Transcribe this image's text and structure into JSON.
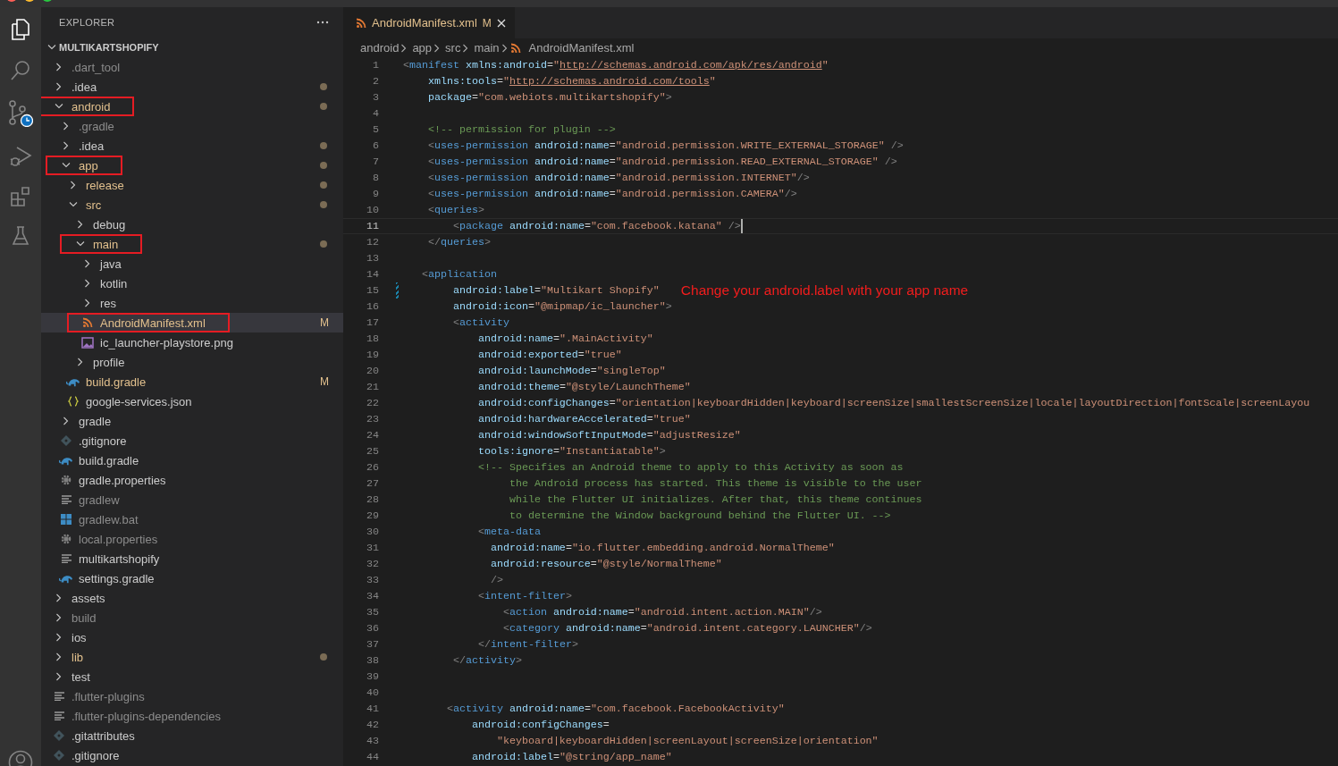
{
  "explorer": {
    "title": "EXPLORER",
    "root": {
      "label": "MULTIKARTSHOPIFY",
      "expanded": true,
      "children": [
        {
          "label": ".dart_tool",
          "kind": "folder",
          "expanded": false,
          "modified": false,
          "ignored": true,
          "dot": false,
          "selected": false,
          "highlighted": false
        },
        {
          "label": ".idea",
          "kind": "folder",
          "expanded": false,
          "modified": false,
          "ignored": false,
          "dot": true,
          "selected": false,
          "highlighted": false
        },
        {
          "label": "android",
          "kind": "folder",
          "expanded": true,
          "modified": true,
          "ignored": false,
          "dot": true,
          "selected": false,
          "highlighted": true,
          "children": [
            {
              "label": ".gradle",
              "kind": "folder",
              "expanded": false,
              "modified": false,
              "ignored": true,
              "dot": false,
              "selected": false,
              "highlighted": false
            },
            {
              "label": ".idea",
              "kind": "folder",
              "expanded": false,
              "modified": false,
              "ignored": false,
              "dot": true,
              "selected": false,
              "highlighted": false
            },
            {
              "label": "app",
              "kind": "folder",
              "expanded": true,
              "modified": true,
              "ignored": false,
              "dot": true,
              "selected": false,
              "highlighted": true,
              "children": [
                {
                  "label": "release",
                  "kind": "folder",
                  "expanded": false,
                  "modified": true,
                  "ignored": false,
                  "dot": true,
                  "selected": false,
                  "highlighted": false
                },
                {
                  "label": "src",
                  "kind": "folder",
                  "expanded": true,
                  "modified": true,
                  "ignored": false,
                  "dot": true,
                  "selected": false,
                  "highlighted": false,
                  "children": [
                    {
                      "label": "debug",
                      "kind": "folder",
                      "expanded": false,
                      "modified": false,
                      "ignored": false,
                      "dot": false,
                      "selected": false,
                      "highlighted": false
                    },
                    {
                      "label": "main",
                      "kind": "folder",
                      "expanded": true,
                      "modified": true,
                      "ignored": false,
                      "dot": true,
                      "selected": false,
                      "highlighted": true,
                      "children": [
                        {
                          "label": "java",
                          "kind": "folder",
                          "expanded": false,
                          "modified": false,
                          "ignored": false,
                          "dot": false,
                          "selected": false,
                          "highlighted": false
                        },
                        {
                          "label": "kotlin",
                          "kind": "folder",
                          "expanded": false,
                          "modified": false,
                          "ignored": false,
                          "dot": false,
                          "selected": false,
                          "highlighted": false
                        },
                        {
                          "label": "res",
                          "kind": "folder",
                          "expanded": false,
                          "modified": false,
                          "ignored": false,
                          "dot": false,
                          "selected": false,
                          "highlighted": false
                        },
                        {
                          "label": "AndroidManifest.xml",
                          "kind": "xml",
                          "modified": true,
                          "ignored": false,
                          "badge": "M",
                          "dot": false,
                          "selected": true,
                          "highlighted": true
                        },
                        {
                          "label": "ic_launcher-playstore.png",
                          "kind": "image",
                          "modified": false,
                          "ignored": false,
                          "dot": false,
                          "selected": false,
                          "highlighted": false
                        }
                      ]
                    },
                    {
                      "label": "profile",
                      "kind": "folder",
                      "expanded": false,
                      "modified": false,
                      "ignored": false,
                      "dot": false,
                      "selected": false,
                      "highlighted": false
                    }
                  ]
                },
                {
                  "label": "build.gradle",
                  "kind": "gradle",
                  "modified": true,
                  "ignored": false,
                  "badge": "M",
                  "dot": false,
                  "selected": false,
                  "highlighted": false
                },
                {
                  "label": "google-services.json",
                  "kind": "json",
                  "modified": false,
                  "ignored": false,
                  "dot": false,
                  "selected": false,
                  "highlighted": false
                }
              ]
            },
            {
              "label": "gradle",
              "kind": "folder",
              "expanded": false,
              "modified": false,
              "ignored": false,
              "dot": false,
              "selected": false,
              "highlighted": false
            },
            {
              "label": ".gitignore",
              "kind": "git",
              "modified": false,
              "ignored": false,
              "dot": false,
              "selected": false,
              "highlighted": false
            },
            {
              "label": "build.gradle",
              "kind": "gradle",
              "modified": false,
              "ignored": false,
              "dot": false,
              "selected": false,
              "highlighted": false
            },
            {
              "label": "gradle.properties",
              "kind": "settings",
              "modified": false,
              "ignored": false,
              "dot": false,
              "selected": false,
              "highlighted": false
            },
            {
              "label": "gradlew",
              "kind": "text",
              "modified": false,
              "ignored": true,
              "dot": false,
              "selected": false,
              "highlighted": false
            },
            {
              "label": "gradlew.bat",
              "kind": "windows",
              "modified": false,
              "ignored": true,
              "dot": false,
              "selected": false,
              "highlighted": false
            },
            {
              "label": "local.properties",
              "kind": "settings",
              "modified": false,
              "ignored": true,
              "dot": false,
              "selected": false,
              "highlighted": false
            },
            {
              "label": "multikartshopify",
              "kind": "text",
              "modified": false,
              "ignored": false,
              "dot": false,
              "selected": false,
              "highlighted": false
            },
            {
              "label": "settings.gradle",
              "kind": "gradle",
              "modified": false,
              "ignored": false,
              "dot": false,
              "selected": false,
              "highlighted": false
            }
          ]
        },
        {
          "label": "assets",
          "kind": "folder",
          "expanded": false,
          "modified": false,
          "ignored": false,
          "dot": false,
          "selected": false,
          "highlighted": false
        },
        {
          "label": "build",
          "kind": "folder",
          "expanded": false,
          "modified": false,
          "ignored": true,
          "dot": false,
          "selected": false,
          "highlighted": false
        },
        {
          "label": "ios",
          "kind": "folder",
          "expanded": false,
          "modified": false,
          "ignored": false,
          "dot": false,
          "selected": false,
          "highlighted": false
        },
        {
          "label": "lib",
          "kind": "folder",
          "expanded": false,
          "modified": true,
          "ignored": false,
          "dot": true,
          "selected": false,
          "highlighted": false
        },
        {
          "label": "test",
          "kind": "folder",
          "expanded": false,
          "modified": false,
          "ignored": false,
          "dot": false,
          "selected": false,
          "highlighted": false
        },
        {
          "label": ".flutter-plugins",
          "kind": "text",
          "modified": false,
          "ignored": true,
          "dot": false,
          "selected": false,
          "highlighted": false
        },
        {
          "label": ".flutter-plugins-dependencies",
          "kind": "text",
          "modified": false,
          "ignored": true,
          "dot": false,
          "selected": false,
          "highlighted": false
        },
        {
          "label": ".gitattributes",
          "kind": "git",
          "modified": false,
          "ignored": false,
          "dot": false,
          "selected": false,
          "highlighted": false
        },
        {
          "label": ".gitignore",
          "kind": "git",
          "modified": false,
          "ignored": false,
          "dot": false,
          "selected": false,
          "highlighted": false
        }
      ]
    }
  },
  "editor": {
    "tabs": [
      {
        "label": "AndroidManifest.xml",
        "kind": "xml",
        "badge": "M",
        "modified": true,
        "selected": true
      }
    ],
    "breadcrumbs": [
      {
        "label": "android",
        "kind": "folder"
      },
      {
        "label": "app",
        "kind": "folder"
      },
      {
        "label": "src",
        "kind": "folder"
      },
      {
        "label": "main",
        "kind": "folder"
      },
      {
        "label": "AndroidManifest.xml",
        "kind": "xml"
      }
    ],
    "lines": [
      {
        "number": "1",
        "current": false,
        "changed": false,
        "tokens": [
          {
            "kind": "punct",
            "text": "<"
          },
          {
            "kind": "tag",
            "text": "manifest"
          },
          {
            "kind": "attr",
            "text": " xmlns:android"
          },
          {
            "kind": "eq",
            "text": "="
          },
          {
            "kind": "string",
            "text": "\""
          },
          {
            "kind": "link",
            "text": "http://schemas.android.com/apk/res/android"
          },
          {
            "kind": "string",
            "text": "\""
          }
        ]
      },
      {
        "number": "2",
        "current": false,
        "changed": false,
        "tokens": [
          {
            "kind": "attr",
            "text": "    xmlns:tools"
          },
          {
            "kind": "eq",
            "text": "="
          },
          {
            "kind": "string",
            "text": "\""
          },
          {
            "kind": "link",
            "text": "http://schemas.android.com/tools"
          },
          {
            "kind": "string",
            "text": "\""
          }
        ]
      },
      {
        "number": "3",
        "current": false,
        "changed": false,
        "tokens": [
          {
            "kind": "attr",
            "text": "    package"
          },
          {
            "kind": "eq",
            "text": "="
          },
          {
            "kind": "string",
            "text": "\"com.webiots.multikartshopify\""
          },
          {
            "kind": "punct",
            "text": ">"
          }
        ]
      },
      {
        "number": "4",
        "current": false,
        "changed": false
      },
      {
        "number": "5",
        "current": false,
        "changed": false,
        "tokens": [
          {
            "kind": "comment",
            "text": "    <!-- permission for plugin -->"
          }
        ]
      },
      {
        "number": "6",
        "current": false,
        "changed": false,
        "tokens": [
          {
            "kind": "punct",
            "text": "    <"
          },
          {
            "kind": "tag",
            "text": "uses-permission"
          },
          {
            "kind": "attr",
            "text": " android:name"
          },
          {
            "kind": "eq",
            "text": "="
          },
          {
            "kind": "string",
            "text": "\"android.permission.WRITE_EXTERNAL_STORAGE\""
          },
          {
            "kind": "punct",
            "text": " />"
          }
        ]
      },
      {
        "number": "7",
        "current": false,
        "changed": false,
        "tokens": [
          {
            "kind": "punct",
            "text": "    <"
          },
          {
            "kind": "tag",
            "text": "uses-permission"
          },
          {
            "kind": "attr",
            "text": " android:name"
          },
          {
            "kind": "eq",
            "text": "="
          },
          {
            "kind": "string",
            "text": "\"android.permission.READ_EXTERNAL_STORAGE\""
          },
          {
            "kind": "punct",
            "text": " />"
          }
        ]
      },
      {
        "number": "8",
        "current": false,
        "changed": false,
        "tokens": [
          {
            "kind": "punct",
            "text": "    <"
          },
          {
            "kind": "tag",
            "text": "uses-permission"
          },
          {
            "kind": "attr",
            "text": " android:name"
          },
          {
            "kind": "eq",
            "text": "="
          },
          {
            "kind": "string",
            "text": "\"android.permission.INTERNET\""
          },
          {
            "kind": "punct",
            "text": "/>"
          }
        ]
      },
      {
        "number": "9",
        "current": false,
        "changed": false,
        "tokens": [
          {
            "kind": "punct",
            "text": "    <"
          },
          {
            "kind": "tag",
            "text": "uses-permission"
          },
          {
            "kind": "attr",
            "text": " android:name"
          },
          {
            "kind": "eq",
            "text": "="
          },
          {
            "kind": "string",
            "text": "\"android.permission.CAMERA\""
          },
          {
            "kind": "punct",
            "text": "/>"
          }
        ]
      },
      {
        "number": "10",
        "current": false,
        "changed": false,
        "tokens": [
          {
            "kind": "punct",
            "text": "    <"
          },
          {
            "kind": "tag",
            "text": "queries"
          },
          {
            "kind": "punct",
            "text": ">"
          }
        ]
      },
      {
        "number": "11",
        "current": true,
        "changed": false,
        "tokens": [
          {
            "kind": "punct",
            "text": "        <"
          },
          {
            "kind": "tag",
            "text": "package"
          },
          {
            "kind": "attr",
            "text": " android:name"
          },
          {
            "kind": "eq",
            "text": "="
          },
          {
            "kind": "string",
            "text": "\"com.facebook.katana\""
          },
          {
            "kind": "punct",
            "text": " />"
          }
        ]
      },
      {
        "number": "12",
        "current": false,
        "changed": false,
        "tokens": [
          {
            "kind": "punct",
            "text": "    </"
          },
          {
            "kind": "tag",
            "text": "queries"
          },
          {
            "kind": "punct",
            "text": ">"
          }
        ]
      },
      {
        "number": "13",
        "current": false,
        "changed": false
      },
      {
        "number": "14",
        "current": false,
        "changed": false,
        "tokens": [
          {
            "kind": "punct",
            "text": "   <"
          },
          {
            "kind": "tag",
            "text": "application"
          }
        ]
      },
      {
        "number": "15",
        "current": false,
        "changed": true,
        "note": "Change your android.label with your app name",
        "tokens": [
          {
            "kind": "attr",
            "text": "        android:label"
          },
          {
            "kind": "eq",
            "text": "="
          },
          {
            "kind": "string",
            "text": "\"Multikart Shopify\""
          }
        ]
      },
      {
        "number": "16",
        "current": false,
        "changed": false,
        "tokens": [
          {
            "kind": "attr",
            "text": "        android:icon"
          },
          {
            "kind": "eq",
            "text": "="
          },
          {
            "kind": "string",
            "text": "\"@mipmap/ic_launcher\""
          },
          {
            "kind": "punct",
            "text": ">"
          }
        ]
      },
      {
        "number": "17",
        "current": false,
        "changed": false,
        "tokens": [
          {
            "kind": "punct",
            "text": "        <"
          },
          {
            "kind": "tag",
            "text": "activity"
          }
        ]
      },
      {
        "number": "18",
        "current": false,
        "changed": false,
        "tokens": [
          {
            "kind": "attr",
            "text": "            android:name"
          },
          {
            "kind": "eq",
            "text": "="
          },
          {
            "kind": "string",
            "text": "\".MainActivity\""
          }
        ]
      },
      {
        "number": "19",
        "current": false,
        "changed": false,
        "tokens": [
          {
            "kind": "attr",
            "text": "            android:exported"
          },
          {
            "kind": "eq",
            "text": "="
          },
          {
            "kind": "string",
            "text": "\"true\""
          }
        ]
      },
      {
        "number": "20",
        "current": false,
        "changed": false,
        "tokens": [
          {
            "kind": "attr",
            "text": "            android:launchMode"
          },
          {
            "kind": "eq",
            "text": "="
          },
          {
            "kind": "string",
            "text": "\"singleTop\""
          }
        ]
      },
      {
        "number": "21",
        "current": false,
        "changed": false,
        "tokens": [
          {
            "kind": "attr",
            "text": "            android:theme"
          },
          {
            "kind": "eq",
            "text": "="
          },
          {
            "kind": "string",
            "text": "\"@style/LaunchTheme\""
          }
        ]
      },
      {
        "number": "22",
        "current": false,
        "changed": false,
        "tokens": [
          {
            "kind": "attr",
            "text": "            android:configChanges"
          },
          {
            "kind": "eq",
            "text": "="
          },
          {
            "kind": "string",
            "text": "\"orientation|keyboardHidden|keyboard|screenSize|smallestScreenSize|locale|layoutDirection|fontScale|screenLayou"
          }
        ]
      },
      {
        "number": "23",
        "current": false,
        "changed": false,
        "tokens": [
          {
            "kind": "attr",
            "text": "            android:hardwareAccelerated"
          },
          {
            "kind": "eq",
            "text": "="
          },
          {
            "kind": "string",
            "text": "\"true\""
          }
        ]
      },
      {
        "number": "24",
        "current": false,
        "changed": false,
        "tokens": [
          {
            "kind": "attr",
            "text": "            android:windowSoftInputMode"
          },
          {
            "kind": "eq",
            "text": "="
          },
          {
            "kind": "string",
            "text": "\"adjustResize\""
          }
        ]
      },
      {
        "number": "25",
        "current": false,
        "changed": false,
        "tokens": [
          {
            "kind": "attr",
            "text": "            tools:ignore"
          },
          {
            "kind": "eq",
            "text": "="
          },
          {
            "kind": "string",
            "text": "\"Instantiatable\""
          },
          {
            "kind": "punct",
            "text": ">"
          }
        ]
      },
      {
        "number": "26",
        "current": false,
        "changed": false,
        "tokens": [
          {
            "kind": "comment",
            "text": "            <!-- Specifies an Android theme to apply to this Activity as soon as"
          }
        ]
      },
      {
        "number": "27",
        "current": false,
        "changed": false,
        "tokens": [
          {
            "kind": "comment",
            "text": "                 the Android process has started. This theme is visible to the user"
          }
        ]
      },
      {
        "number": "28",
        "current": false,
        "changed": false,
        "tokens": [
          {
            "kind": "comment",
            "text": "                 while the Flutter UI initializes. After that, this theme continues"
          }
        ]
      },
      {
        "number": "29",
        "current": false,
        "changed": false,
        "tokens": [
          {
            "kind": "comment",
            "text": "                 to determine the Window background behind the Flutter UI. -->"
          }
        ]
      },
      {
        "number": "30",
        "current": false,
        "changed": false,
        "tokens": [
          {
            "kind": "punct",
            "text": "            <"
          },
          {
            "kind": "tag",
            "text": "meta-data"
          }
        ]
      },
      {
        "number": "31",
        "current": false,
        "changed": false,
        "tokens": [
          {
            "kind": "attr",
            "text": "              android:name"
          },
          {
            "kind": "eq",
            "text": "="
          },
          {
            "kind": "string",
            "text": "\"io.flutter.embedding.android.NormalTheme\""
          }
        ]
      },
      {
        "number": "32",
        "current": false,
        "changed": false,
        "tokens": [
          {
            "kind": "attr",
            "text": "              android:resource"
          },
          {
            "kind": "eq",
            "text": "="
          },
          {
            "kind": "string",
            "text": "\"@style/NormalTheme\""
          }
        ]
      },
      {
        "number": "33",
        "current": false,
        "changed": false,
        "tokens": [
          {
            "kind": "punct",
            "text": "              />"
          }
        ]
      },
      {
        "number": "34",
        "current": false,
        "changed": false,
        "tokens": [
          {
            "kind": "punct",
            "text": "            <"
          },
          {
            "kind": "tag",
            "text": "intent-filter"
          },
          {
            "kind": "punct",
            "text": ">"
          }
        ]
      },
      {
        "number": "35",
        "current": false,
        "changed": false,
        "tokens": [
          {
            "kind": "punct",
            "text": "                <"
          },
          {
            "kind": "tag",
            "text": "action"
          },
          {
            "kind": "attr",
            "text": " android:name"
          },
          {
            "kind": "eq",
            "text": "="
          },
          {
            "kind": "string",
            "text": "\"android.intent.action.MAIN\""
          },
          {
            "kind": "punct",
            "text": "/>"
          }
        ]
      },
      {
        "number": "36",
        "current": false,
        "changed": false,
        "tokens": [
          {
            "kind": "punct",
            "text": "                <"
          },
          {
            "kind": "tag",
            "text": "category"
          },
          {
            "kind": "attr",
            "text": " android:name"
          },
          {
            "kind": "eq",
            "text": "="
          },
          {
            "kind": "string",
            "text": "\"android.intent.category.LAUNCHER\""
          },
          {
            "kind": "punct",
            "text": "/>"
          }
        ]
      },
      {
        "number": "37",
        "current": false,
        "changed": false,
        "tokens": [
          {
            "kind": "punct",
            "text": "            </"
          },
          {
            "kind": "tag",
            "text": "intent-filter"
          },
          {
            "kind": "punct",
            "text": ">"
          }
        ]
      },
      {
        "number": "38",
        "current": false,
        "changed": false,
        "tokens": [
          {
            "kind": "punct",
            "text": "        </"
          },
          {
            "kind": "tag",
            "text": "activity"
          },
          {
            "kind": "punct",
            "text": ">"
          }
        ]
      },
      {
        "number": "39",
        "current": false,
        "changed": false
      },
      {
        "number": "40",
        "current": false,
        "changed": false
      },
      {
        "number": "41",
        "current": false,
        "changed": false,
        "tokens": [
          {
            "kind": "punct",
            "text": "       <"
          },
          {
            "kind": "tag",
            "text": "activity"
          },
          {
            "kind": "attr",
            "text": " android:name"
          },
          {
            "kind": "eq",
            "text": "="
          },
          {
            "kind": "string",
            "text": "\"com.facebook.FacebookActivity\""
          }
        ]
      },
      {
        "number": "42",
        "current": false,
        "changed": false,
        "tokens": [
          {
            "kind": "attr",
            "text": "           android:configChanges"
          },
          {
            "kind": "eq",
            "text": "="
          }
        ]
      },
      {
        "number": "43",
        "current": false,
        "changed": false,
        "tokens": [
          {
            "kind": "string",
            "text": "               \"keyboard|keyboardHidden|screenLayout|screenSize|orientation\""
          }
        ]
      },
      {
        "number": "44",
        "current": false,
        "changed": false,
        "tokens": [
          {
            "kind": "attr",
            "text": "           android:label"
          },
          {
            "kind": "eq",
            "text": "="
          },
          {
            "kind": "string",
            "text": "\"@string/app_name\""
          }
        ]
      }
    ]
  }
}
